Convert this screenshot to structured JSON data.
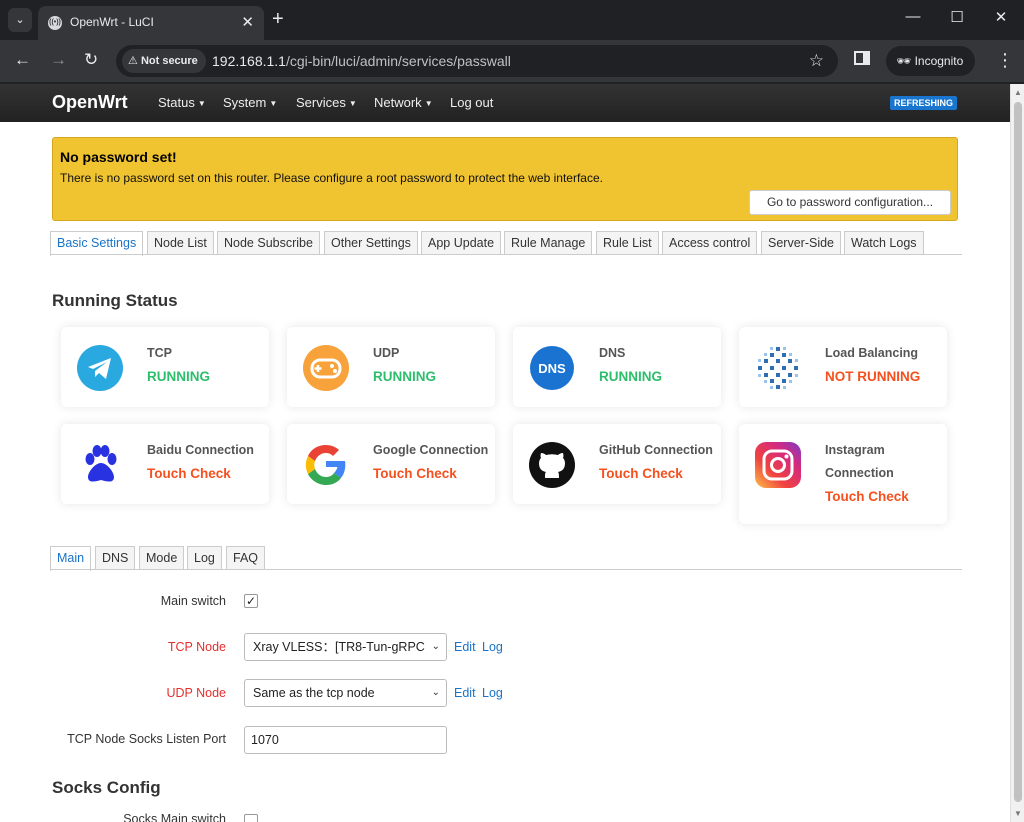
{
  "browser": {
    "tab_title": "OpenWrt - LuCI",
    "security_label": "Not secure",
    "url_host": "192.168.1.1",
    "url_path": "/cgi-bin/luci/admin/services/passwall",
    "incognito_label": "Incognito"
  },
  "navbar": {
    "brand": "OpenWrt",
    "items": [
      "Status",
      "System",
      "Services",
      "Network",
      "Log out"
    ],
    "badge": "REFRESHING"
  },
  "alert": {
    "title": "No password set!",
    "text": "There is no password set on this router. Please configure a root password to protect the web interface.",
    "button": "Go to password configuration..."
  },
  "tabs": [
    "Basic Settings",
    "Node List",
    "Node Subscribe",
    "Other Settings",
    "App Update",
    "Rule Manage",
    "Rule List",
    "Access control",
    "Server-Side",
    "Watch Logs"
  ],
  "running_status": {
    "title": "Running Status",
    "cards": [
      {
        "label": "TCP",
        "status": "RUNNING",
        "icon": "telegram-icon"
      },
      {
        "label": "UDP",
        "status": "RUNNING",
        "icon": "gamepad-icon"
      },
      {
        "label": "DNS",
        "status": "RUNNING",
        "icon": "dns-icon"
      },
      {
        "label": "Load Balancing",
        "status": "NOT RUNNING",
        "icon": "load-balancing-icon"
      },
      {
        "label": "Baidu Connection",
        "status": "Touch Check",
        "icon": "baidu-icon"
      },
      {
        "label": "Google Connection",
        "status": "Touch Check",
        "icon": "google-icon"
      },
      {
        "label": "GitHub Connection",
        "status": "Touch Check",
        "icon": "github-icon"
      },
      {
        "label_line1": "Instagram",
        "label_line2": "Connection",
        "status": "Touch Check",
        "icon": "instagram-icon"
      }
    ]
  },
  "main_tabs": [
    "Main",
    "DNS",
    "Mode",
    "Log",
    "FAQ"
  ],
  "form": {
    "main_switch_label": "Main switch",
    "main_switch_checked": true,
    "tcp_node_label": "TCP Node",
    "tcp_node_value": "Xray VLESS：[TR8-Tun-gRPC",
    "udp_node_label": "UDP Node",
    "udp_node_value": "Same as the tcp node",
    "edit_label": "Edit",
    "log_label": "Log",
    "socks_port_label": "TCP Node Socks Listen Port",
    "socks_port_value": "1070"
  },
  "socks_config": {
    "title": "Socks Config",
    "main_switch_label": "Socks Main switch"
  },
  "colors": {
    "running": "#2dbe6c",
    "not_running": "#f5501e",
    "link": "#1a73c8",
    "alert_bg": "#f0c330"
  }
}
